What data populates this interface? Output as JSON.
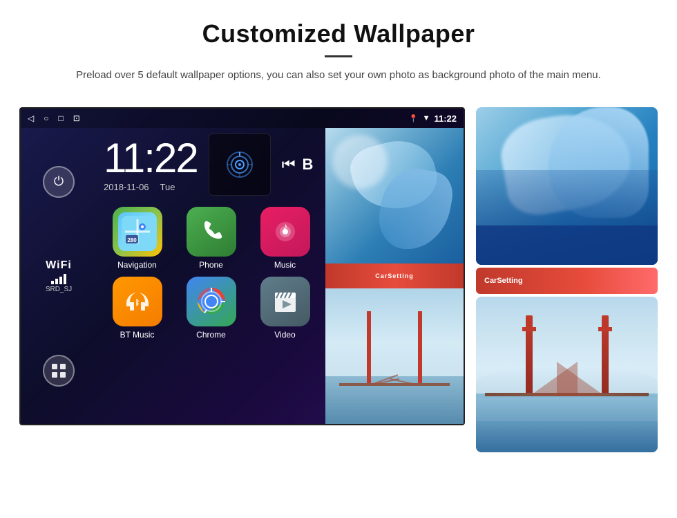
{
  "header": {
    "title": "Customized Wallpaper",
    "description": "Preload over 5 default wallpaper options, you can also set your own photo as background photo of the main menu."
  },
  "android": {
    "statusBar": {
      "time": "11:22",
      "backIcon": "◁",
      "homeIcon": "○",
      "squareIcon": "□",
      "screenshotIcon": "⊡"
    },
    "clock": {
      "time": "11:22",
      "date": "2018-11-06",
      "day": "Tue"
    },
    "wifi": {
      "label": "WiFi",
      "ssid": "SRD_SJ"
    },
    "apps": [
      {
        "name": "Navigation",
        "type": "navigation"
      },
      {
        "name": "Phone",
        "type": "phone"
      },
      {
        "name": "Music",
        "type": "music"
      },
      {
        "name": "BT Music",
        "type": "btmusic"
      },
      {
        "name": "Chrome",
        "type": "chrome"
      },
      {
        "name": "Video",
        "type": "video"
      }
    ]
  }
}
